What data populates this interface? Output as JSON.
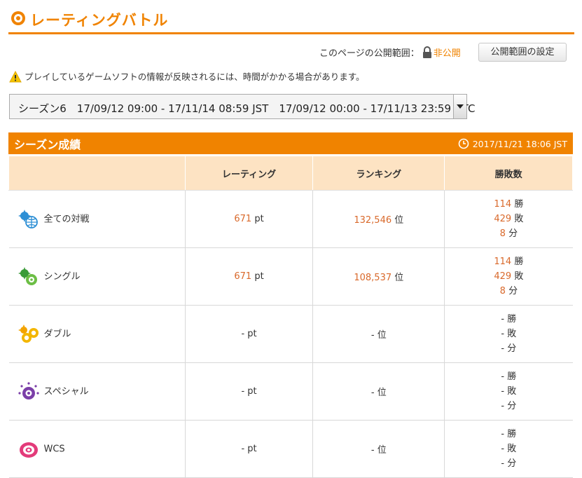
{
  "header": {
    "title": "レーティングバトル"
  },
  "visibility": {
    "label": "このページの公開範囲：",
    "state": "非公開",
    "settings_button": "公開範囲の設定"
  },
  "notice": "プレイしているゲームソフトの情報が反映されるには、時間がかかる場合があります。",
  "season_select": {
    "value": "シーズン6　17/09/12 09:00 - 17/11/14 08:59 JST　17/09/12 00:00 - 17/11/13 23:59 UTC"
  },
  "results": {
    "title": "シーズン成績",
    "timestamp": "2017/11/21 18:06 JST",
    "columns": [
      "",
      "レーティング",
      "ランキング",
      "勝敗数"
    ],
    "units": {
      "rating": "pt",
      "rank": "位",
      "win": "勝",
      "lose": "敗",
      "draw": "分"
    },
    "rows": [
      {
        "icon": "all-battles-icon",
        "mode": "全ての対戦",
        "rating": "671",
        "rank": "132,546",
        "win": "114",
        "lose": "429",
        "draw": "8"
      },
      {
        "icon": "single-battle-icon",
        "mode": "シングル",
        "rating": "671",
        "rank": "108,537",
        "win": "114",
        "lose": "429",
        "draw": "8"
      },
      {
        "icon": "double-battle-icon",
        "mode": "ダブル",
        "rating": "-",
        "rank": "-",
        "win": "-",
        "lose": "-",
        "draw": "-"
      },
      {
        "icon": "special-battle-icon",
        "mode": "スペシャル",
        "rating": "-",
        "rank": "-",
        "win": "-",
        "lose": "-",
        "draw": "-"
      },
      {
        "icon": "wcs-icon",
        "mode": "WCS",
        "rating": "-",
        "rank": "-",
        "win": "-",
        "lose": "-",
        "draw": "-"
      }
    ]
  },
  "colors": {
    "accent": "#f08300",
    "header_bg": "#fde3c3",
    "number": "#d9692b"
  }
}
